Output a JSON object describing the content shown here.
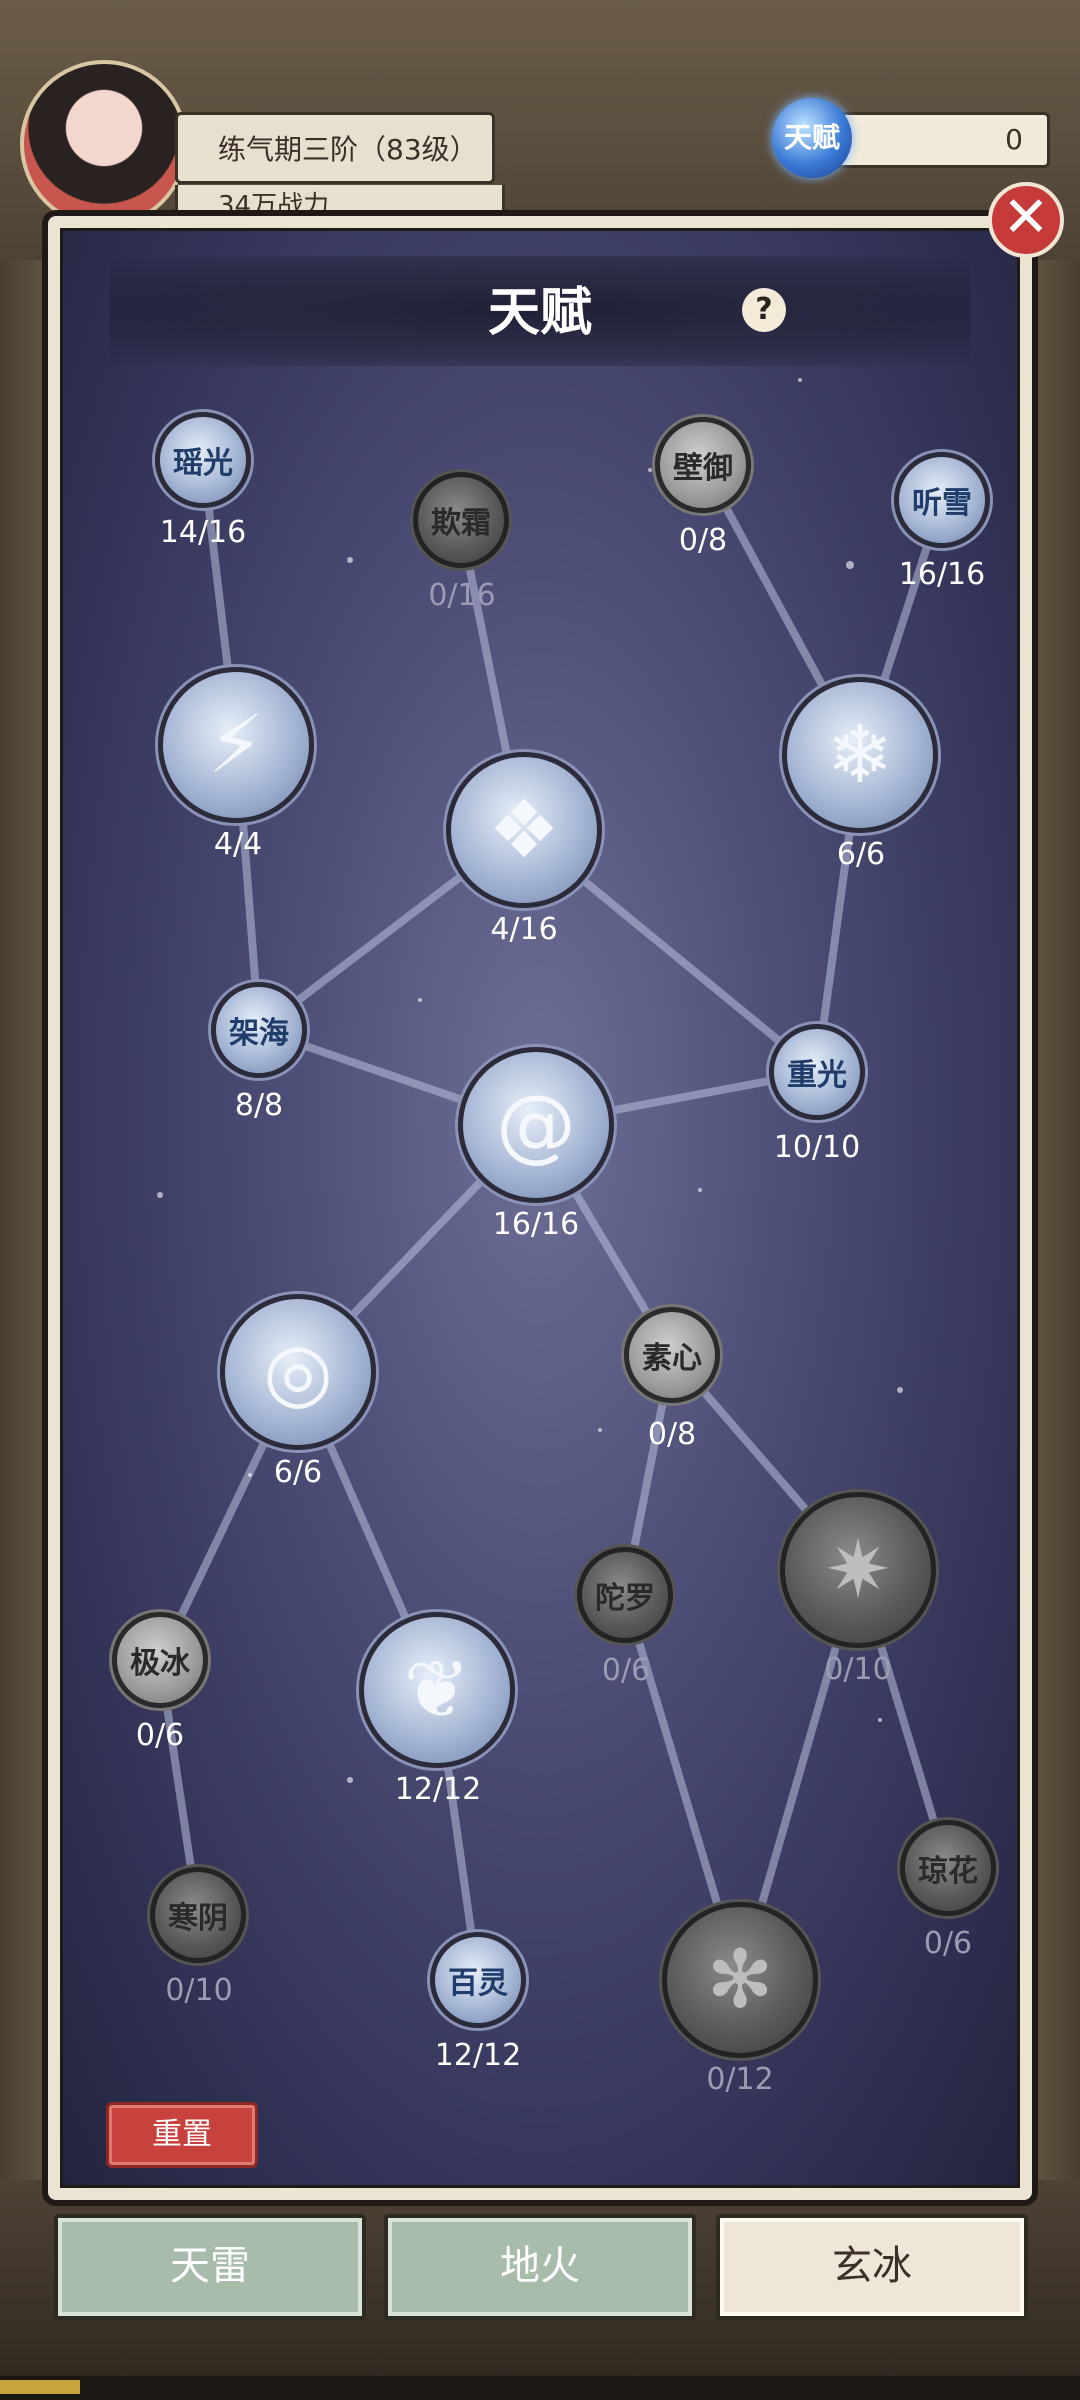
{
  "hud": {
    "level_text": "练气期三阶（83级）",
    "power_text": "34万战力",
    "talent_orb_label": "天赋",
    "talent_points": "0"
  },
  "panel": {
    "title": "天赋",
    "help_label": "?",
    "close_label": "✕",
    "reset_label": "重置"
  },
  "nodes": [
    {
      "id": "yaoguang",
      "label": "瑶光",
      "count": "14/16",
      "state": "on"
    },
    {
      "id": "qishuang",
      "label": "欺霜",
      "count": "0/16",
      "state": "off"
    },
    {
      "id": "biyu",
      "label": "壁御",
      "count": "0/8",
      "state": "off2"
    },
    {
      "id": "tingxue",
      "label": "听雪",
      "count": "16/16",
      "state": "on"
    },
    {
      "id": "lightning",
      "label": "",
      "count": "4/4",
      "state": "on",
      "icon": "ice-shard-icon"
    },
    {
      "id": "shards",
      "label": "",
      "count": "4/16",
      "state": "on",
      "icon": "ice-crystal-icon"
    },
    {
      "id": "snowflake",
      "label": "",
      "count": "6/6",
      "state": "on",
      "icon": "snowflake-icon"
    },
    {
      "id": "jiahai",
      "label": "架海",
      "count": "8/8",
      "state": "on"
    },
    {
      "id": "chongguang",
      "label": "重光",
      "count": "10/10",
      "state": "on"
    },
    {
      "id": "core",
      "label": "",
      "count": "16/16",
      "state": "on",
      "icon": "swirl-icon"
    },
    {
      "id": "vortex",
      "label": "",
      "count": "6/6",
      "state": "on",
      "icon": "vortex-icon"
    },
    {
      "id": "suxin",
      "label": "素心",
      "count": "0/8",
      "state": "off2"
    },
    {
      "id": "tuoluo",
      "label": "陀罗",
      "count": "0/6",
      "state": "off"
    },
    {
      "id": "star",
      "label": "",
      "count": "0/10",
      "state": "off",
      "icon": "star-burst-icon"
    },
    {
      "id": "jibing",
      "label": "极冰",
      "count": "0/6",
      "state": "off2"
    },
    {
      "id": "feathers",
      "label": "",
      "count": "12/12",
      "state": "on",
      "icon": "feather-icon"
    },
    {
      "id": "hanyin",
      "label": "寒阴",
      "count": "0/10",
      "state": "off"
    },
    {
      "id": "bailing",
      "label": "百灵",
      "count": "12/12",
      "state": "on"
    },
    {
      "id": "bigflake",
      "label": "",
      "count": "0/12",
      "state": "off",
      "icon": "frost-flake-icon"
    },
    {
      "id": "qionghua",
      "label": "琼花",
      "count": "0/6",
      "state": "off"
    }
  ],
  "tabs": [
    {
      "label": "天雷",
      "active": false
    },
    {
      "label": "地火",
      "active": false
    },
    {
      "label": "玄冰",
      "active": true
    }
  ],
  "colors": {
    "node_unlocked": "#a5b6d4",
    "node_locked": "#5a5a5a",
    "panel_bg": "#4b4c74",
    "reset_button": "#c7423d",
    "tab_inactive": "#a8bcac",
    "tab_active": "#eee6d6"
  }
}
